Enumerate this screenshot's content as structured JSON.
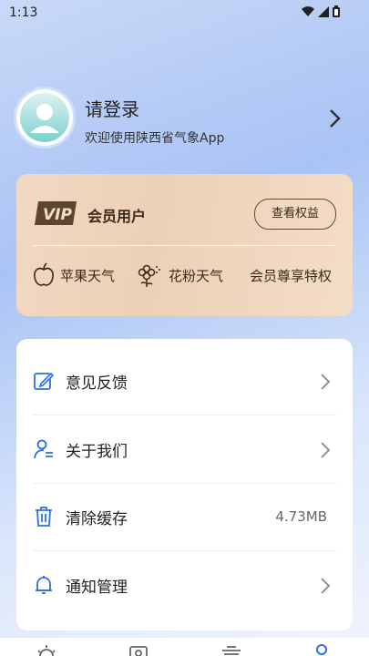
{
  "status_bar": {
    "time": "1:13",
    "icons": [
      "wifi-icon",
      "signal-icon",
      "battery-icon"
    ]
  },
  "profile": {
    "title": "请登录",
    "subtitle": "欢迎使用陕西省气象App"
  },
  "vip": {
    "badge": "VIP",
    "title": "会员用户",
    "button_label": "查看权益",
    "features": [
      {
        "icon": "apple-icon",
        "label": "苹果天气"
      },
      {
        "icon": "flower-icon",
        "label": "花粉天气"
      },
      {
        "icon": "",
        "label": "会员尊享特权"
      }
    ]
  },
  "menu": {
    "items": [
      {
        "icon": "feedback-edit-icon",
        "label": "意见反馈",
        "value": ""
      },
      {
        "icon": "about-user-icon",
        "label": "关于我们",
        "value": ""
      },
      {
        "icon": "trash-icon",
        "label": "清除缓存",
        "value": "4.73MB"
      },
      {
        "icon": "bell-icon",
        "label": "通知管理",
        "value": ""
      }
    ]
  },
  "tab_bar": {
    "tabs": [
      "weather-tab-icon",
      "photo-tab-icon",
      "service-tab-icon",
      "profile-tab-icon"
    ]
  },
  "colors": {
    "accent": "#2f6fe6",
    "vip_bg": "#efd4bc",
    "vip_text": "#3b2a18"
  }
}
